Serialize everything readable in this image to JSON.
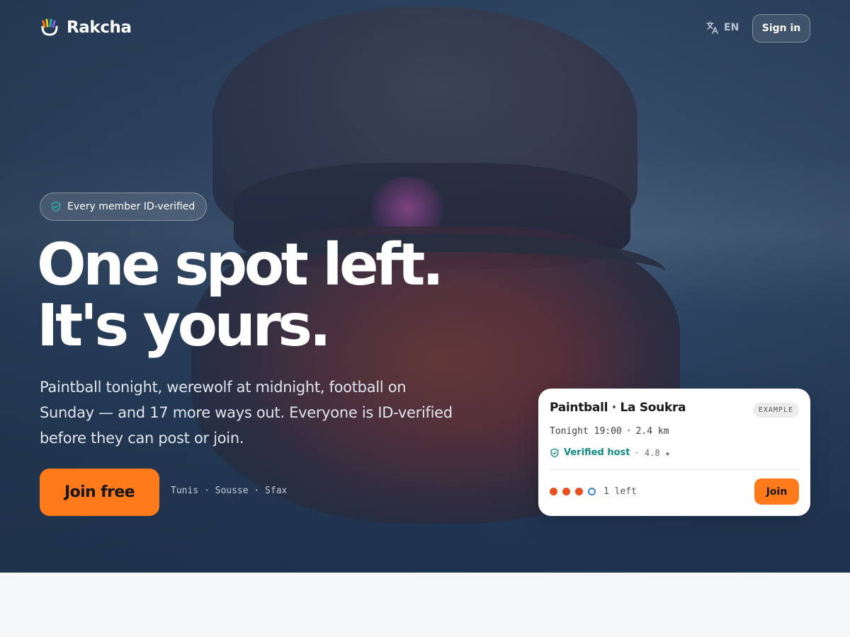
{
  "header": {
    "brand": "Rakcha",
    "language": "EN",
    "sign_in_label": "Sign in"
  },
  "hero": {
    "badge": "Every member ID-verified",
    "headline_line1": "One spot left.",
    "headline_line2": "It's yours.",
    "subtext": "Paintball tonight, werewolf at midnight, football on Sunday — and 17 more ways out. Everyone is ID-verified before they can post or join.",
    "cta_label": "Join free",
    "cities": "Tunis · Sousse · Sfax"
  },
  "card": {
    "title": "Paintball · La Soukra",
    "tag": "EXAMPLE",
    "time": "Tonight 19:00",
    "distance": "2.4 km",
    "host_label": "Verified host",
    "rating": "· 4.8 ★",
    "spots_taken": 3,
    "spots_total": 4,
    "spots_left_text": "1 left",
    "join_label": "Join"
  },
  "colors": {
    "accent": "#ff7a1a",
    "verified": "#0f8a82",
    "spot_taken": "#e8501f",
    "spot_open": "#3b82d6"
  },
  "icons": {
    "logo": "hand-logo-icon",
    "language": "translate-icon",
    "shield": "shield-check-icon"
  }
}
